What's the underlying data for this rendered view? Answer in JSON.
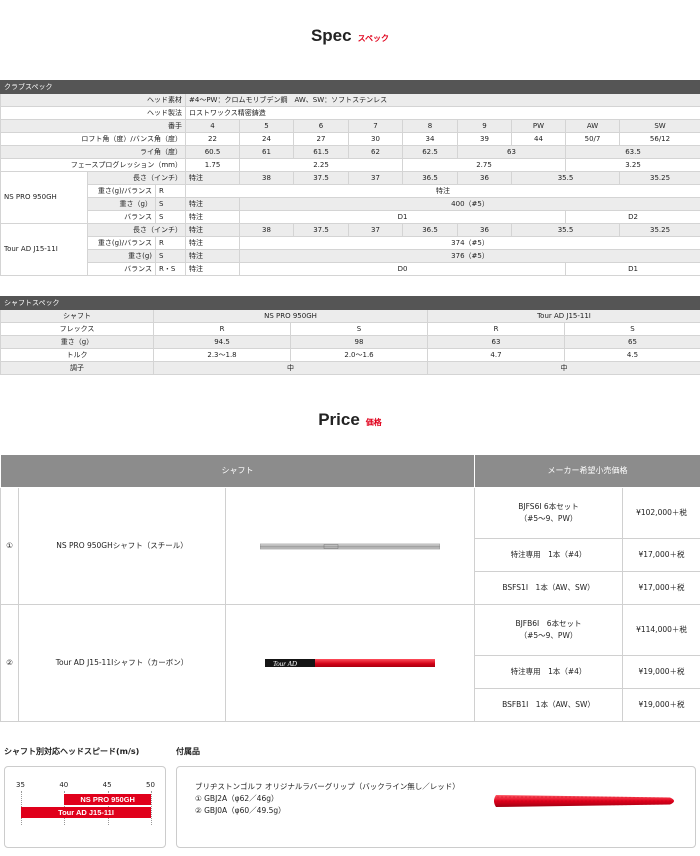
{
  "spec_heading": {
    "en": "Spec",
    "ja": "スペック"
  },
  "club_spec": {
    "title": "クラブスペック",
    "head_material_label": "ヘッド素材",
    "head_material": "#4〜PW：クロムモリブデン鋼　AW、SW：ソフトステンレス",
    "head_mfg_label": "ヘッド製法",
    "head_mfg": "ロストワックス精密鋳造",
    "number_label": "番手",
    "numbers": [
      "4",
      "5",
      "6",
      "7",
      "8",
      "9",
      "PW",
      "AW",
      "SW"
    ],
    "loft_label": "ロフト角（度）/バンス角（度）",
    "loft": [
      "22",
      "24",
      "27",
      "30",
      "34",
      "39",
      "44",
      "50/7",
      "56/12"
    ],
    "lie_label": "ライ角（度）",
    "lie": [
      "60.5",
      "61",
      "61.5",
      "62",
      "62.5",
      "63",
      "63.5"
    ],
    "fp_label": "フェースプログレッション（mm）",
    "fp": [
      "1.75",
      "2.25",
      "2.75",
      "3.25"
    ],
    "ns": {
      "name": "NS PRO 950GH",
      "length_label": "長さ（インチ）",
      "length_special": "特注",
      "lengths": [
        "38",
        "37.5",
        "37",
        "36.5",
        "36",
        "35.5",
        "35.25"
      ],
      "wb_label": "重さ(g)/バランス",
      "wb_flex": "R",
      "wb_value": "特注",
      "weight_label": "重さ（g）",
      "weight_flex": "S",
      "weight_special": "特注",
      "weight_value": "400（#5）",
      "balance_label": "バランス",
      "balance_flex": "S",
      "balance_special": "特注",
      "balance_d1": "D1",
      "balance_d2": "D2"
    },
    "tour": {
      "name": "Tour AD J15-11I",
      "length_label": "長さ（インチ）",
      "length_special": "特注",
      "lengths": [
        "38",
        "37.5",
        "37",
        "36.5",
        "36",
        "35.5",
        "35.25"
      ],
      "wb_label": "重さ(g)/バランス",
      "wb_flex": "R",
      "wb_special": "特注",
      "wb_value": "374（#5）",
      "weight_label": "重さ(g)",
      "weight_flex": "S",
      "weight_special": "特注",
      "weight_value": "376（#5）",
      "balance_label": "バランス",
      "balance_flex": "R・S",
      "balance_special": "特注",
      "balance_d0": "D0",
      "balance_d1": "D1"
    }
  },
  "shaft_spec": {
    "title": "シャフトスペック",
    "shaft_label": "シャフト",
    "shaft_ns": "NS PRO 950GH",
    "shaft_tour": "Tour AD J15-11I",
    "flex_label": "フレックス",
    "flex": [
      "R",
      "S",
      "R",
      "S"
    ],
    "weight_label": "重さ（g）",
    "weight": [
      "94.5",
      "98",
      "63",
      "65"
    ],
    "torque_label": "トルク",
    "torque": [
      "2.3〜1.8",
      "2.0〜1.6",
      "4.7",
      "4.5"
    ],
    "kick_label": "調子",
    "kick": [
      "中",
      "中"
    ]
  },
  "price_heading": {
    "en": "Price",
    "ja": "価格"
  },
  "price": {
    "col_shaft": "シャフト",
    "col_price": "メーカー希望小売価格",
    "rows": [
      {
        "num": "①",
        "name": "NS PRO 950GHシャフト（スチール）",
        "items": [
          {
            "desc": "BJFS6I 6本セット\n（#5〜9、PW）",
            "price": "¥102,000＋税"
          },
          {
            "desc": "特注専用　1本（#4）",
            "price": "¥17,000＋税"
          },
          {
            "desc": "BSFS1I　1本（AW、SW）",
            "price": "¥17,000＋税"
          }
        ]
      },
      {
        "num": "②",
        "name": "Tour AD J15-11Iシャフト（カーボン）",
        "items": [
          {
            "desc": "BJFB6I　6本セット\n（#5〜9、PW）",
            "price": "¥114,000＋税"
          },
          {
            "desc": "特注専用　1本（#4）",
            "price": "¥19,000＋税"
          },
          {
            "desc": "BSFB1I　1本（AW、SW）",
            "price": "¥19,000＋税"
          }
        ]
      }
    ]
  },
  "speed": {
    "title": "シャフト別対応ヘッドスピード(m/s)",
    "ticks": [
      "35",
      "40",
      "45",
      "50"
    ],
    "bars": [
      {
        "name": "NS PRO 950GH",
        "from": 40,
        "to": 50
      },
      {
        "name": "Tour AD J15-11I",
        "from": 35,
        "to": 50
      }
    ]
  },
  "accessory": {
    "title": "付属品",
    "line1": "ブリヂストンゴルフ オリジナルラバーグリップ（バックライン無し／レッド）",
    "line2": "① GBJ2A（φ62／46g）",
    "line3": "② GBJ0A（φ60／49.5g）"
  },
  "shaft_logo_text": "Tour AD"
}
